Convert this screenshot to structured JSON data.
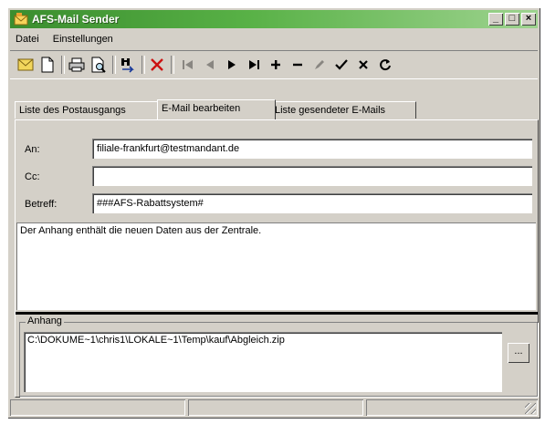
{
  "window": {
    "title": "AFS-Mail Sender",
    "minimize": "_",
    "maximize": "□",
    "close": "×"
  },
  "menu": [
    {
      "label": "Datei"
    },
    {
      "label": "Einstellungen"
    }
  ],
  "tabs": [
    {
      "label": "Liste des Postausgangs"
    },
    {
      "label": "E-Mail bearbeiten",
      "active": true
    },
    {
      "label": "Liste gesendeter E-Mails"
    }
  ],
  "form": {
    "to_label": "An:",
    "to_value": "filiale-frankfurt@testmandant.de",
    "cc_label": "Cc:",
    "cc_value": "",
    "subject_label": "Betreff:",
    "subject_value": "###AFS-Rabattsystem#"
  },
  "body_text": "Der Anhang enthält die neuen Daten aus der Zentrale.",
  "attachment": {
    "group_label": "Anhang",
    "path": "C:\\DOKUME~1\\chris1\\LOKALE~1\\Temp\\kauf\\Abgleich.zip",
    "browse_label": "..."
  },
  "colors": {
    "titlebar": "#58b146",
    "delete_red": "#cc1111",
    "face": "#d4d0c8"
  }
}
